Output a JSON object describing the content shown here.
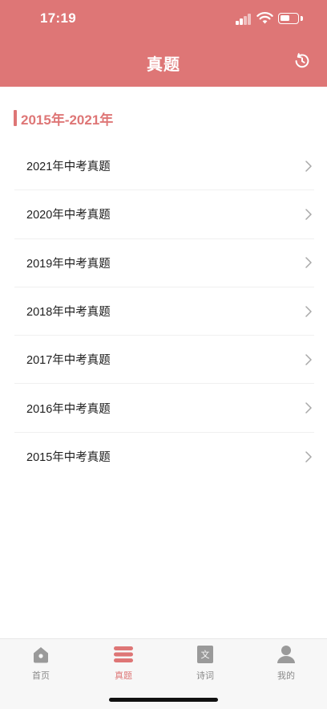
{
  "status_bar": {
    "time": "17:19"
  },
  "header": {
    "title": "真题"
  },
  "section": {
    "title": "2015年-2021年"
  },
  "papers": [
    {
      "label": "2021年中考真题"
    },
    {
      "label": "2020年中考真题"
    },
    {
      "label": "2019年中考真题"
    },
    {
      "label": "2018年中考真题"
    },
    {
      "label": "2017年中考真题"
    },
    {
      "label": "2016年中考真题"
    },
    {
      "label": "2015年中考真题"
    }
  ],
  "tabbar": {
    "tabs": [
      {
        "label": "首页",
        "icon": "home-icon",
        "active": false
      },
      {
        "label": "真题",
        "icon": "stack-icon",
        "active": true
      },
      {
        "label": "诗词",
        "icon": "book-icon",
        "active": false,
        "icon_text": "文"
      },
      {
        "label": "我的",
        "icon": "user-icon",
        "active": false
      }
    ]
  },
  "colors": {
    "accent": "#de7676",
    "inactive": "#8a8a8a",
    "text": "#1f1f1f"
  }
}
